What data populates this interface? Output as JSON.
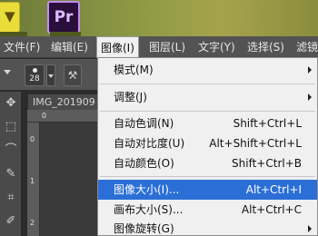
{
  "app_icons": {
    "pr_label": "Pr",
    "yellow_glyph": "▼"
  },
  "menubar": {
    "items": [
      {
        "label": "文件(F)"
      },
      {
        "label": "编辑(E)"
      },
      {
        "label": "图像(I)"
      },
      {
        "label": "图层(L)"
      },
      {
        "label": "文字(Y)"
      },
      {
        "label": "选择(S)"
      },
      {
        "label": "滤镜"
      }
    ]
  },
  "options": {
    "brush_size": "28"
  },
  "document": {
    "tab_title": "IMG_201909",
    "ruler_top": "0",
    "ruler_left_0": "0",
    "ruler_left_1": "1",
    "ruler_left_2": "2"
  },
  "image_menu": {
    "items": [
      {
        "label": "模式(M)",
        "shortcut": "",
        "submenu": true
      },
      {
        "label": "调整(J)",
        "shortcut": "",
        "submenu": true
      },
      {
        "label": "自动色调(N)",
        "shortcut": "Shift+Ctrl+L",
        "submenu": false
      },
      {
        "label": "自动对比度(U)",
        "shortcut": "Alt+Shift+Ctrl+L",
        "submenu": false
      },
      {
        "label": "自动颜色(O)",
        "shortcut": "Shift+Ctrl+B",
        "submenu": false
      },
      {
        "label": "图像大小(I)...",
        "shortcut": "Alt+Ctrl+I",
        "submenu": false
      },
      {
        "label": "画布大小(S)...",
        "shortcut": "Alt+Ctrl+C",
        "submenu": false
      },
      {
        "label": "图像旋转(G)",
        "shortcut": "",
        "submenu": true
      }
    ],
    "highlighted": "图像大小(I)..."
  },
  "colors": {
    "menu_highlight": "#2b6fd6",
    "menu_bg": "#f0f0f0",
    "chrome": "#535353"
  }
}
